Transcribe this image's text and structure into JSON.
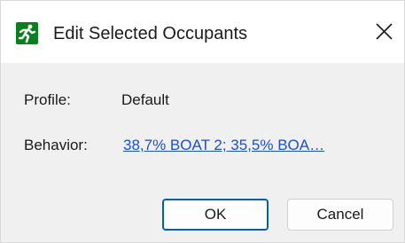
{
  "window": {
    "title": "Edit Selected Occupants",
    "icon": "running-person-icon",
    "close_icon": "close-icon",
    "accent_color": "#0a7f1e"
  },
  "fields": {
    "profile_label": "Profile:",
    "profile_value": "Default",
    "behavior_label": "Behavior:",
    "behavior_value": "38,7% BOAT 2; 35,5% BOA…"
  },
  "buttons": {
    "ok_label": "OK",
    "cancel_label": "Cancel"
  }
}
